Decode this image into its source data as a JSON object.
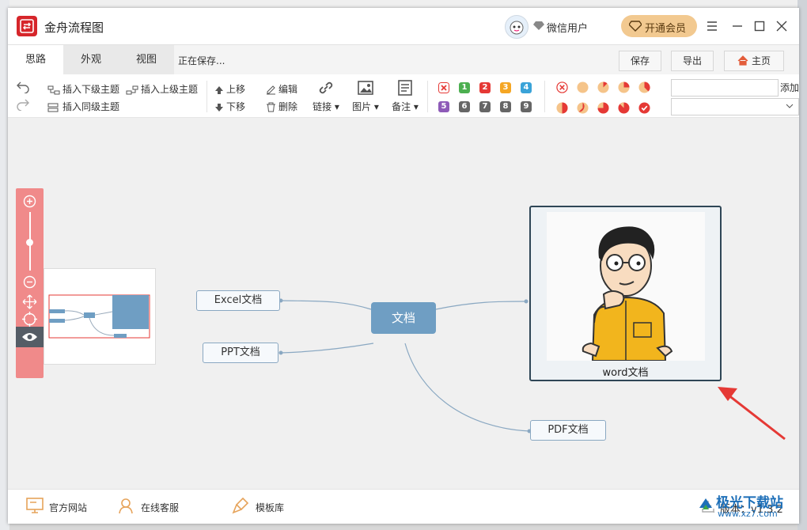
{
  "app": {
    "title": "金舟流程图",
    "user_name": "微信用户",
    "vip_label": "开通会员"
  },
  "tabs": [
    {
      "label": "思路",
      "active": true
    },
    {
      "label": "外观",
      "active": false
    },
    {
      "label": "视图",
      "active": false
    }
  ],
  "status_text": "正在保存...",
  "top_buttons": {
    "save": "保存",
    "export": "导出",
    "home": "主页"
  },
  "toolbar": {
    "insert_child": "插入下级主题",
    "insert_parent": "插入上级主题",
    "insert_sibling": "插入同级主题",
    "move_up": "上移",
    "move_down": "下移",
    "edit": "编辑",
    "delete": "删除",
    "link": "链接",
    "image": "图片",
    "note": "备注",
    "add": "添加",
    "priorities": [
      "1",
      "2",
      "3",
      "4",
      "5",
      "6",
      "7",
      "8",
      "9"
    ],
    "priority_colors": [
      "#4caf50",
      "#e53935",
      "#f5a623",
      "#3aa3d8",
      "#8e5bb8",
      "#666666",
      "#666666",
      "#666666",
      "#666666"
    ]
  },
  "mindmap": {
    "root": "文档",
    "nodes": {
      "excel": "Excel文档",
      "ppt": "PPT文档",
      "word": "word文档",
      "pdf": "PDF文档"
    }
  },
  "statusbar": {
    "website": "官方网站",
    "service": "在线客服",
    "templates": "模板库",
    "version": "版本：v1.3.2"
  },
  "watermark": {
    "text": "极光下载站",
    "url": "www.xz7.com"
  },
  "colors": {
    "root_node": "#6f9ec3",
    "zoom_panel": "#f08a8a",
    "logo": "#d6262b",
    "arrow": "#e53935"
  }
}
